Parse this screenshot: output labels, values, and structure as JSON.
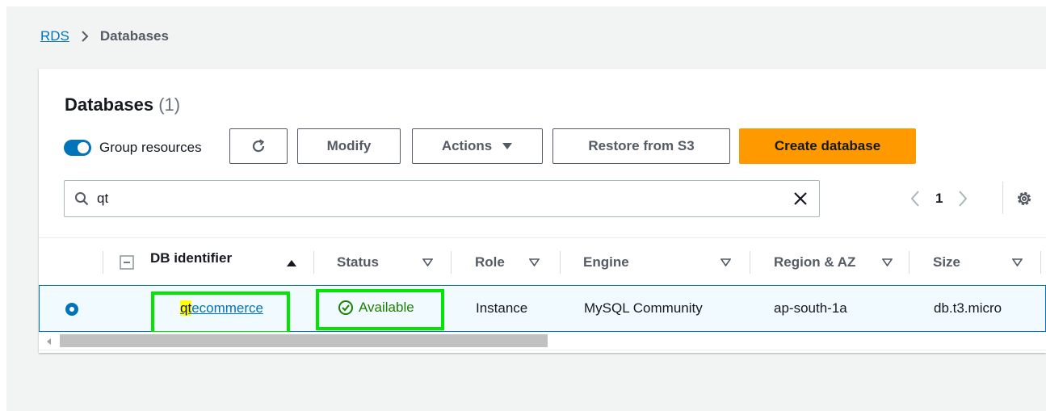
{
  "breadcrumb": {
    "root": "RDS",
    "current": "Databases"
  },
  "panel": {
    "title": "Databases",
    "count": "(1)"
  },
  "toolbar": {
    "group_resources_label": "Group resources",
    "group_resources_on": true,
    "modify_label": "Modify",
    "actions_label": "Actions",
    "restore_label": "Restore from S3",
    "create_label": "Create database"
  },
  "search": {
    "value": "qt"
  },
  "pagination": {
    "current_page": "1"
  },
  "table": {
    "columns": [
      "DB identifier",
      "Status",
      "Role",
      "Engine",
      "Region & AZ",
      "Size"
    ],
    "rows": [
      {
        "db_identifier_match": "qt",
        "db_identifier_rest": "ecommerce",
        "status": "Available",
        "role": "Instance",
        "engine": "MySQL Community",
        "region_az": "ap-south-1a",
        "size": "db.t3.micro",
        "selected": true
      }
    ]
  },
  "colors": {
    "accent": "#0073bb",
    "primary_button": "#ff9900",
    "status_available": "#1d8102",
    "highlight": "#ffff00",
    "annotation_box": "#00e600"
  }
}
